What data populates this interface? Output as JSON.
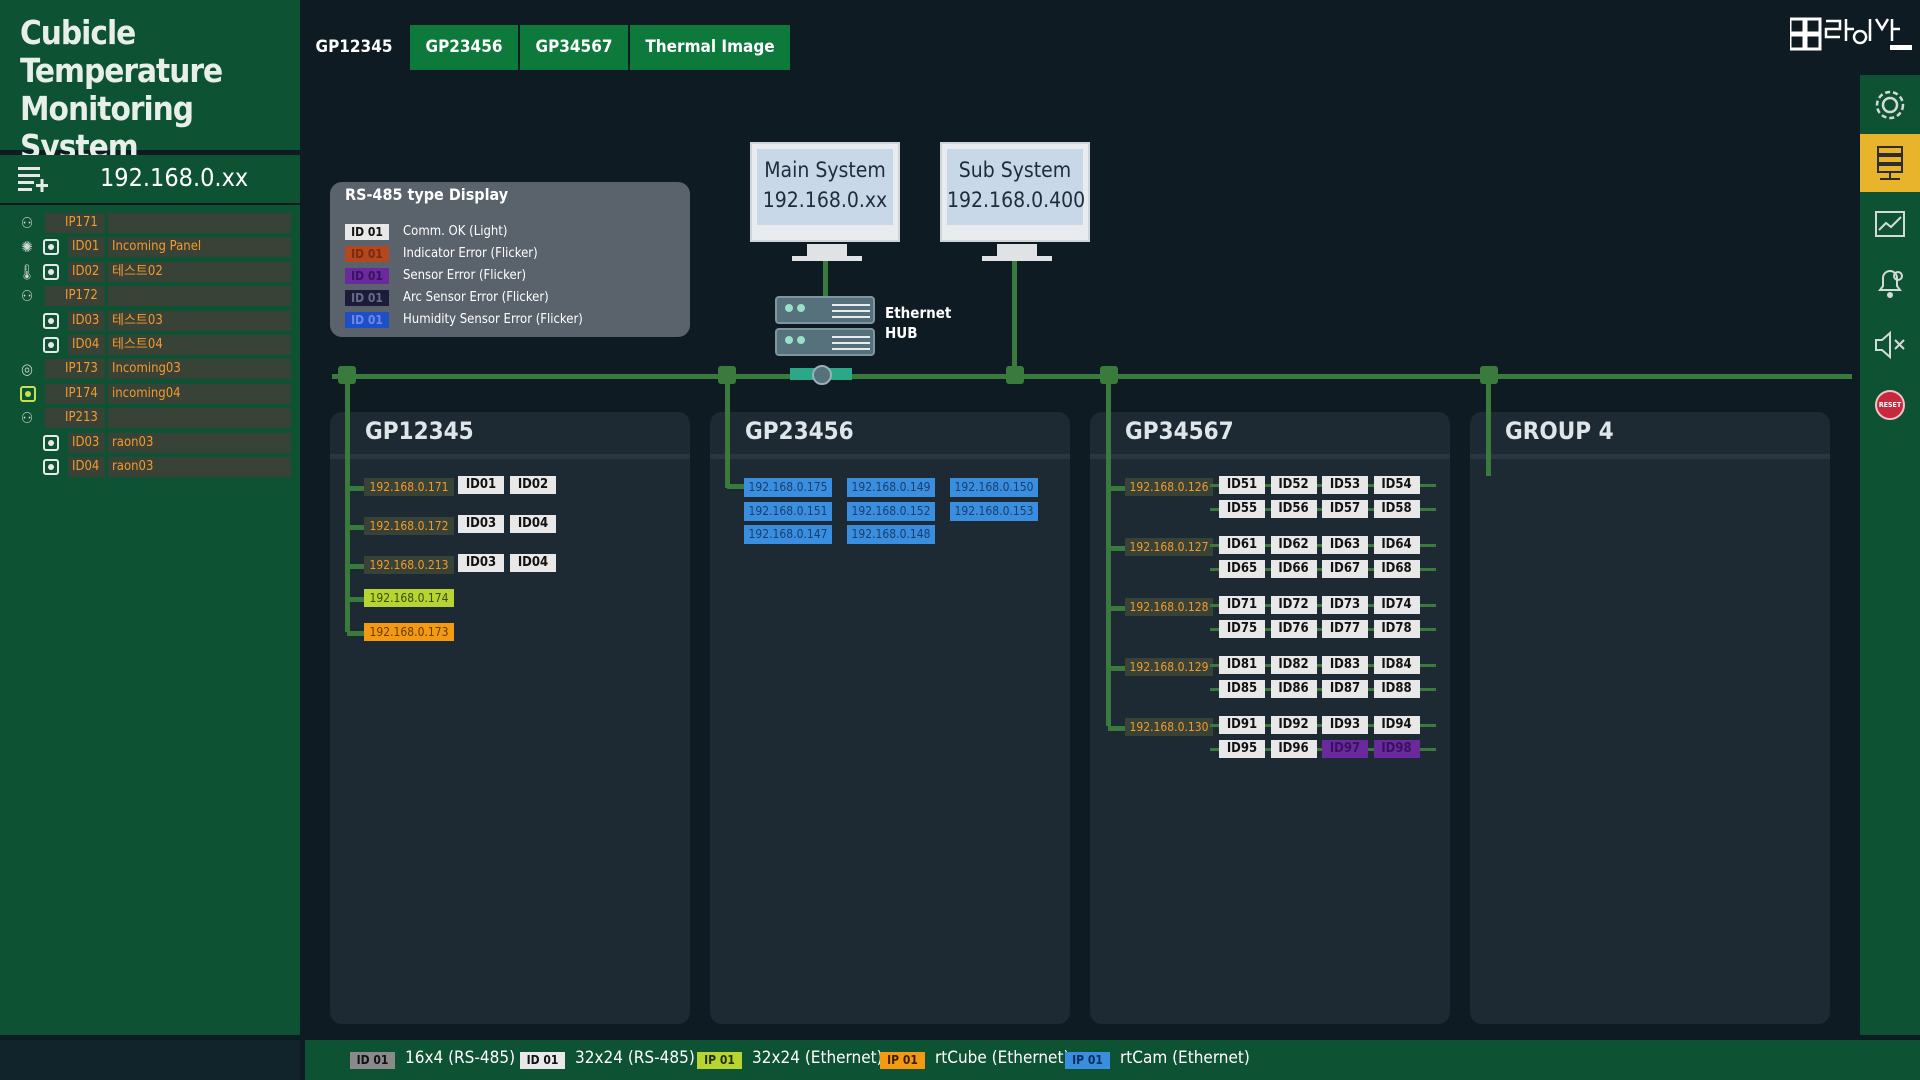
{
  "app": {
    "title": "Cubicle Temperature Monitoring System"
  },
  "ip_header": {
    "label": "192.168.0.xx",
    "icon": "list-add-icon"
  },
  "tree": [
    {
      "icon": "network-icon",
      "c1": "IP171",
      "c2": "",
      "sub": false
    },
    {
      "icon": "sun-icon",
      "c1": "ID01",
      "c2": "Incoming Panel",
      "sub": true,
      "dev": true
    },
    {
      "icon": "thermometer-icon",
      "c1": "ID02",
      "c2": "테스트02",
      "sub": true,
      "dev": true
    },
    {
      "icon": "network-icon",
      "c1": "IP172",
      "c2": "",
      "sub": false
    },
    {
      "icon": "",
      "c1": "ID03",
      "c2": "테스트03",
      "sub": true,
      "dev": true
    },
    {
      "icon": "",
      "c1": "ID04",
      "c2": "테스트04",
      "sub": true,
      "dev": true
    },
    {
      "icon": "camera-icon",
      "c1": "IP173",
      "c2": "Incoming03",
      "sub": false
    },
    {
      "icon": "device-icon",
      "c1": "IP174",
      "c2": "incoming04",
      "sub": false
    },
    {
      "icon": "network-icon",
      "c1": "IP213",
      "c2": "",
      "sub": false
    },
    {
      "icon": "",
      "c1": "ID03",
      "c2": "raon03",
      "sub": true,
      "dev": true
    },
    {
      "icon": "",
      "c1": "ID04",
      "c2": "raon03",
      "sub": true,
      "dev": true
    }
  ],
  "tabs": [
    "GP12345",
    "GP23456",
    "GP34567",
    "Thermal Image"
  ],
  "right_toolbar": [
    "gear-icon",
    "server-icon",
    "chart-icon",
    "alarm-settings-icon",
    "mute-icon",
    "reset-icon"
  ],
  "reset_label": "RESET",
  "logo": {
    "icon": "raon-logo-icon"
  },
  "legend": {
    "title": "RS-485 type Display",
    "items": [
      {
        "chip": "ID 01",
        "text": "Comm. OK (Light)",
        "bg": "#e8e8e8",
        "fg": "#111111"
      },
      {
        "chip": "ID 01",
        "text": "Indicator Error (Flicker)",
        "bg": "#b5471e",
        "fg": "#7a2a10"
      },
      {
        "chip": "ID 01",
        "text": "Sensor Error (Flicker)",
        "bg": "#6a2a9e",
        "fg": "#3a1060"
      },
      {
        "chip": "ID 01",
        "text": "Arc Sensor Error (Flicker)",
        "bg": "#1c1c3a",
        "fg": "#6a6a8a"
      },
      {
        "chip": "ID 01",
        "text": "Humidity Sensor Error (Flicker)",
        "bg": "#1e4fc8",
        "fg": "#6a8ae8"
      }
    ]
  },
  "main_system": {
    "label": "Main System",
    "ip": "192.168.0.xx"
  },
  "sub_system": {
    "label": "Sub System",
    "ip": "192.168.0.400"
  },
  "hub": {
    "label": "Ethernet HUB"
  },
  "groups": [
    {
      "title": "GP12345"
    },
    {
      "title": "GP23456"
    },
    {
      "title": "GP34567"
    },
    {
      "title": "GROUP 4"
    }
  ],
  "gp1": {
    "rows": [
      {
        "ip": "192.168.0.171",
        "ids": [
          "ID01",
          "ID02"
        ]
      },
      {
        "ip": "192.168.0.172",
        "ids": [
          "ID03",
          "ID04"
        ]
      },
      {
        "ip": "192.168.0.213",
        "ids": [
          "ID03",
          "ID04"
        ]
      }
    ],
    "eth": [
      {
        "ip": "192.168.0.174",
        "bg": "#b8d432",
        "fg": "#3a4a10"
      },
      {
        "ip": "192.168.0.173",
        "bg": "#f39a12",
        "fg": "#6a3a00"
      }
    ]
  },
  "gp2": {
    "cams": [
      "192.168.0.175",
      "192.168.0.149",
      "192.168.0.150",
      "192.168.0.151",
      "192.168.0.152",
      "192.168.0.153",
      "192.168.0.147",
      "192.168.0.148"
    ]
  },
  "gp3": {
    "rows": [
      {
        "ip": "192.168.0.126",
        "ids": [
          "ID51",
          "ID52",
          "ID53",
          "ID54",
          "ID55",
          "ID56",
          "ID57",
          "ID58"
        ]
      },
      {
        "ip": "192.168.0.127",
        "ids": [
          "ID61",
          "ID62",
          "ID63",
          "ID64",
          "ID65",
          "ID66",
          "ID67",
          "ID68"
        ]
      },
      {
        "ip": "192.168.0.128",
        "ids": [
          "ID71",
          "ID72",
          "ID73",
          "ID74",
          "ID75",
          "ID76",
          "ID77",
          "ID78"
        ]
      },
      {
        "ip": "192.168.0.129",
        "ids": [
          "ID81",
          "ID82",
          "ID83",
          "ID84",
          "ID85",
          "ID86",
          "ID87",
          "ID88"
        ]
      },
      {
        "ip": "192.168.0.130",
        "ids": [
          "ID91",
          "ID92",
          "ID93",
          "ID94",
          "ID95",
          "ID96",
          "ID97",
          "ID98"
        ]
      }
    ],
    "error_ids": [
      "ID97",
      "ID98"
    ]
  },
  "footer": [
    {
      "chip": "ID 01",
      "text": "16x4 (RS-485)",
      "bg": "#8a8a8a",
      "fg": "#111111"
    },
    {
      "chip": "ID 01",
      "text": "32x24 (RS-485)",
      "bg": "#e8e8e8",
      "fg": "#111111"
    },
    {
      "chip": "IP 01",
      "text": "32x24 (Ethernet)",
      "bg": "#b8d432",
      "fg": "#223300"
    },
    {
      "chip": "IP 01",
      "text": "rtCube (Ethernet)",
      "bg": "#f39a12",
      "fg": "#3a1e00"
    },
    {
      "chip": "IP 01",
      "text": "rtCam (Ethernet)",
      "bg": "#3a8ee0",
      "fg": "#0a2a5a"
    }
  ]
}
